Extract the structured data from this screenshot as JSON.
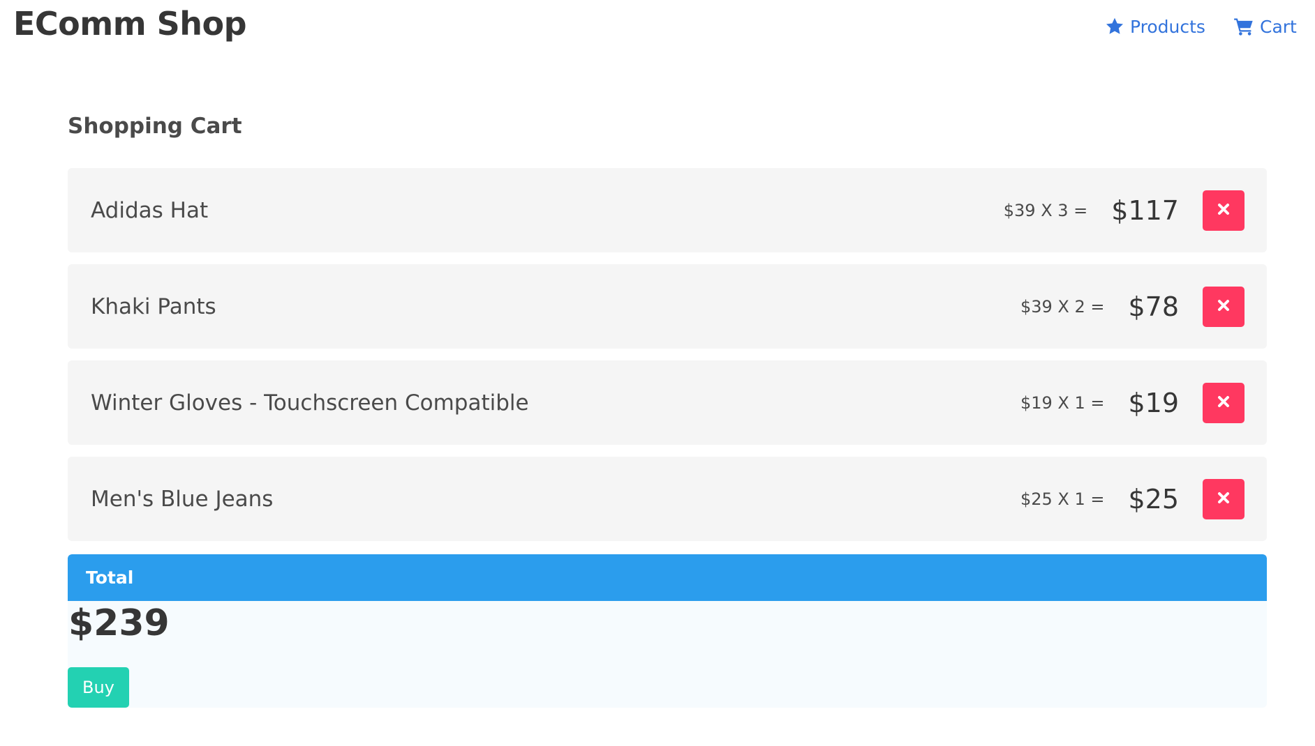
{
  "navbar": {
    "brand": "EComm Shop",
    "links": [
      {
        "label": "Products",
        "icon": "star-icon"
      },
      {
        "label": "Cart",
        "icon": "cart-icon"
      }
    ]
  },
  "cart": {
    "title": "Shopping Cart",
    "items": [
      {
        "name": "Adidas Hat",
        "calc": "$39 X 3 =",
        "subtotal": "$117"
      },
      {
        "name": "Khaki Pants",
        "calc": "$39 X 2 =",
        "subtotal": "$78"
      },
      {
        "name": "Winter Gloves - Touchscreen Compatible",
        "calc": "$19 X 1 =",
        "subtotal": "$19"
      },
      {
        "name": "Men's Blue Jeans",
        "calc": "$25 X 1 =",
        "subtotal": "$25"
      }
    ],
    "remove_icon": "close-icon"
  },
  "total": {
    "label": "Total",
    "amount": "$239",
    "buy_label": "Buy"
  },
  "colors": {
    "link": "#3273dc",
    "danger": "#ff3860",
    "info": "#2b9ded",
    "primary": "#23d1b2",
    "item_bg": "#f5f5f5"
  }
}
